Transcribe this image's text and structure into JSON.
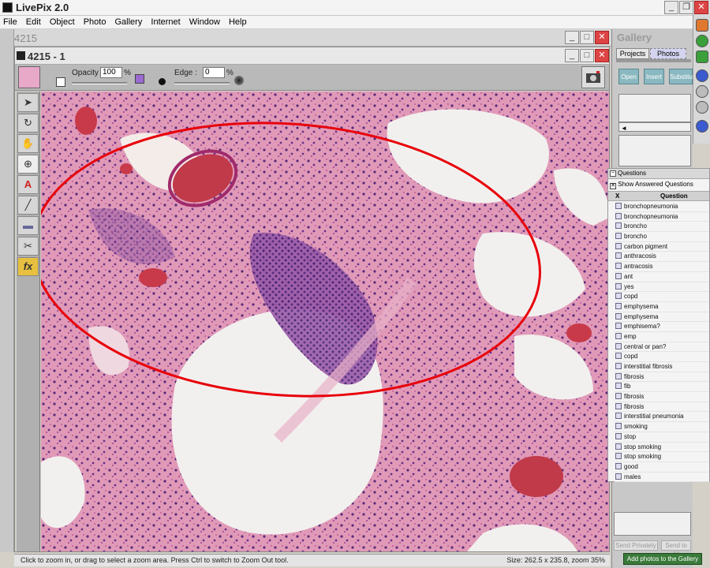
{
  "app": {
    "title": "LivePix 2.0"
  },
  "menu": [
    "File",
    "Edit",
    "Object",
    "Photo",
    "Gallery",
    "Internet",
    "Window",
    "Help"
  ],
  "outer_window": {
    "title": "4215"
  },
  "inner_window": {
    "title": "4215 - 1"
  },
  "options": {
    "opacity_label": "Opacity :",
    "opacity_value": "100",
    "opacity_unit": "%",
    "edge_label": "Edge :",
    "edge_value": "0",
    "edge_unit": "%"
  },
  "status": {
    "hint": "Click to zoom in, or drag to select a zoom area. Press Ctrl to switch to Zoom Out tool.",
    "size": "Size: 262.5 x 235.8, zoom 35%"
  },
  "gallery": {
    "title": "Gallery",
    "tabs": [
      "Projects",
      "Photos"
    ],
    "active_tab": "Photos",
    "buttons": [
      "Open",
      "Insert",
      "Substitute"
    ]
  },
  "questions": {
    "panel_title": "Questions",
    "show_answered": "Show Answered Questions",
    "col_x": "X",
    "col_question": "Question",
    "items": [
      "bronchopneumonia",
      "bronchopneumonia",
      "broncho",
      "broncho",
      "carbon pigment",
      "anthracosis",
      "antracosis",
      "ant",
      "yes",
      "copd",
      "emphysema",
      "emphysema",
      "emphisema?",
      "emp",
      "central or pan?",
      "copd",
      "interstitial fibrosis",
      "fibrosis",
      "fib",
      "fibrosis",
      "fibrosis",
      "interstitial pneumonia",
      "smoking",
      "stop",
      "stop smoking",
      "stop smoking",
      "good",
      "males"
    ],
    "send_privately": "Send Privately",
    "send_to_all": "Send to All"
  },
  "add_photos": "Add photos to the Gallery",
  "colors": {
    "annotation": "#e8000a",
    "tissue_bg": "#e2a0be"
  }
}
